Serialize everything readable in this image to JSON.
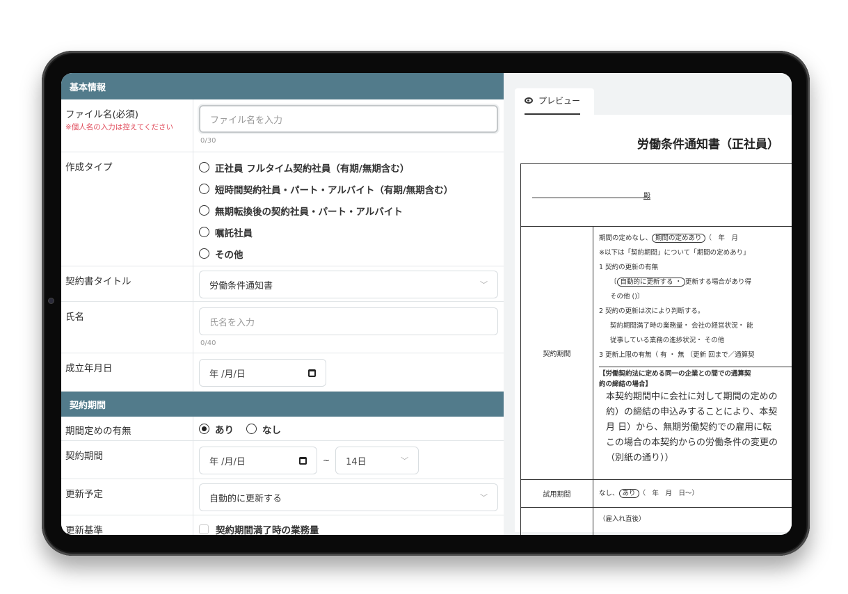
{
  "form": {
    "section_basic": "基本情報",
    "filename": {
      "label": "ファイル名(必須)",
      "warning": "※個人名の入力は控えてください",
      "placeholder": "ファイル名を入力",
      "counter": "0/30"
    },
    "create_type": {
      "label": "作成タイプ",
      "options": [
        "正社員 フルタイム契約社員（有期/無期含む）",
        "短時間契約社員・パート・アルバイト（有期/無期含む）",
        "無期転換後の契約社員・パート・アルバイト",
        "嘱託社員",
        "その他"
      ]
    },
    "contract_title": {
      "label": "契約書タイトル",
      "value": "労働条件通知書"
    },
    "name": {
      "label": "氏名",
      "placeholder": "氏名を入力",
      "counter": "0/40"
    },
    "established_date": {
      "label": "成立年月日",
      "value": "年 /月/日"
    },
    "section_period": "契約期間",
    "period_defined": {
      "label": "期間定めの有無",
      "option_yes": "あり",
      "option_no": "なし",
      "selected": "あり"
    },
    "contract_period": {
      "label": "契約期間",
      "start": "年 /月/日",
      "tilde": "~",
      "end": "14日"
    },
    "renewal_plan": {
      "label": "更新予定",
      "value": "自動的に更新する"
    },
    "renewal_criteria": {
      "label": "更新基準",
      "first_option": "契約期間満了時の業務量"
    }
  },
  "preview": {
    "tab_label": "プレビュー",
    "doc_title": "労働条件通知書（正社員）",
    "dono": "殿",
    "period_label": "契約期間",
    "period_lines": {
      "l1a": "期間の定めなし、",
      "l1pill": "期間の定めあり",
      "l1b": "（　年　月",
      "l2": "※以下は「契約期間」について「期間の定めあり」",
      "l3": "1 契約の更新の有無",
      "l4a": "〔",
      "l4pill": "自動的に更新する ・",
      "l4b": "更新する場合があり得",
      "l5": "その他 ()〕",
      "l6": "2 契約の更新は次により判断する。",
      "l7": "契約期間満了時の業務量・ 会社の経営状況・ 能",
      "l8": "従事している業務の進捗状況・ その他",
      "l9": "3 更新上限の有無（ 有 ・ 無 （更新 回まで／通算契",
      "l10": "【労働契約法に定める同一の企業との間での通算契",
      "l11": "約の締結の場合】",
      "l12": "本契約期間中に会社に対して期間の定めの",
      "l13": "約）の締結の申込みすることにより、本契",
      "l14": "月 日）から、無期労働契約での雇用に転",
      "l15": "この場合の本契約からの労働条件の変更の",
      "l16": "（別紙の通り））"
    },
    "trial_label": "試用期間",
    "trial_a": "なし、",
    "trial_pill": "あり",
    "trial_b": "（　年　月　日〜）",
    "next_line": "（雇入れ直後）"
  }
}
